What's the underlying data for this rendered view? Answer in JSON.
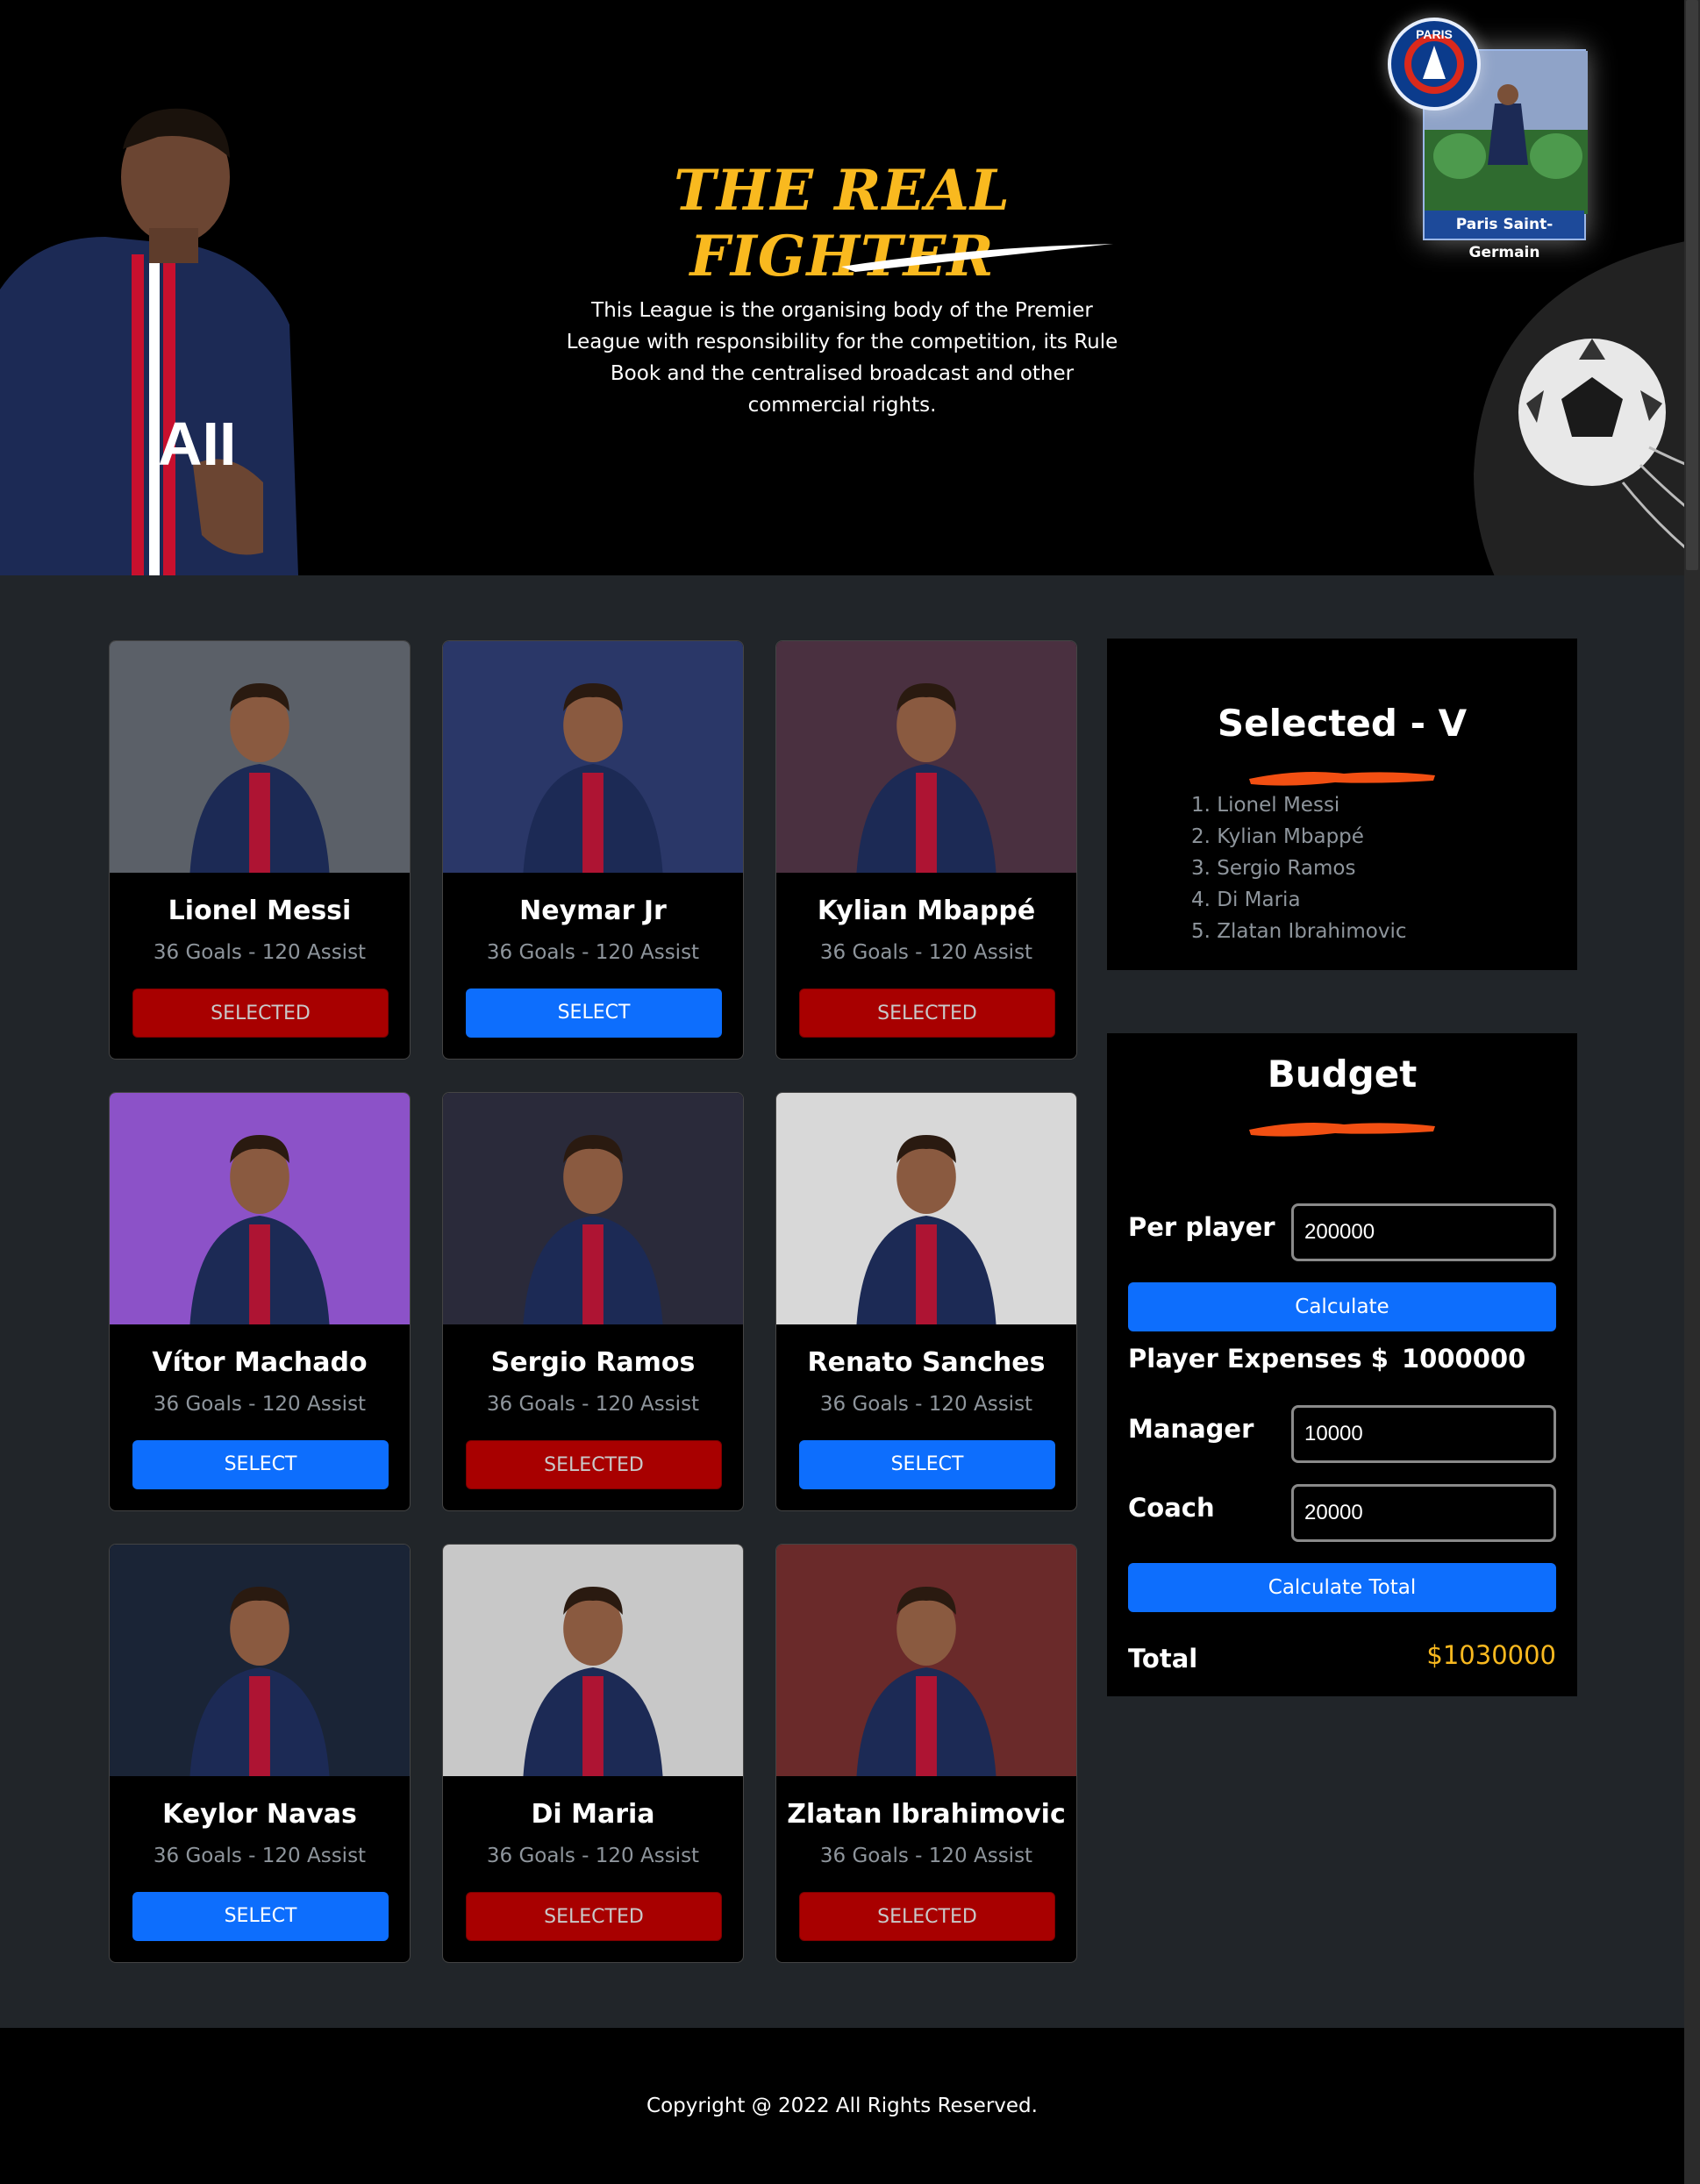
{
  "hero": {
    "title": "THE REAL FIGHTER",
    "description": "This League is the organising body of the Premier League with responsibility for the competition, its Rule Book and the centralised broadcast and other commercial rights.",
    "badge_text": "PARIS",
    "card_label": "Paris Saint-Germain"
  },
  "players": [
    {
      "name": "Lionel Messi",
      "stats": "36 Goals - 120 Assist",
      "button": "SELECTED",
      "selected": true,
      "bg": "#5b6068"
    },
    {
      "name": "Neymar Jr",
      "stats": "36 Goals - 120 Assist",
      "button": "SELECT",
      "selected": false,
      "bg": "#2a3768"
    },
    {
      "name": "Kylian Mbappé",
      "stats": "36 Goals - 120 Assist",
      "button": "SELECTED",
      "selected": true,
      "bg": "#4a3040"
    },
    {
      "name": "Vítor Machado",
      "stats": "36 Goals - 120 Assist",
      "button": "SELECT",
      "selected": false,
      "bg": "#8c52c8"
    },
    {
      "name": "Sergio Ramos",
      "stats": "36 Goals - 120 Assist",
      "button": "SELECTED",
      "selected": true,
      "bg": "#2a2a3a"
    },
    {
      "name": "Renato Sanches",
      "stats": "36 Goals - 120 Assist",
      "button": "SELECT",
      "selected": false,
      "bg": "#d8d8d8"
    },
    {
      "name": "Keylor Navas",
      "stats": "36 Goals - 120 Assist",
      "button": "SELECT",
      "selected": false,
      "bg": "#1a2436"
    },
    {
      "name": "Di Maria",
      "stats": "36 Goals - 120 Assist",
      "button": "SELECTED",
      "selected": true,
      "bg": "#c8c8c8"
    },
    {
      "name": "Zlatan Ibrahimovic",
      "stats": "36 Goals - 120 Assist",
      "button": "SELECTED",
      "selected": true,
      "bg": "#6a2a2a"
    }
  ],
  "selected_panel": {
    "title": "Selected - V",
    "items": [
      "Lionel Messi",
      "Kylian Mbappé",
      "Sergio Ramos",
      "Di Maria",
      "Zlatan Ibrahimovic"
    ]
  },
  "budget": {
    "title": "Budget",
    "per_player_label": "Per player",
    "per_player_value": "200000",
    "calculate_label": "Calculate",
    "player_expenses_label": "Player Expenses $",
    "player_expenses_value": "1000000",
    "manager_label": "Manager",
    "manager_value": "10000",
    "coach_label": "Coach",
    "coach_value": "20000",
    "calculate_total_label": "Calculate Total",
    "total_label": "Total",
    "total_value": "$1030000"
  },
  "footer": {
    "copyright": "Copyright @ 2022 All Rights Reserved."
  },
  "colors": {
    "accent_gold": "#f9b91f",
    "primary_blue": "#0d6efd",
    "selected_red": "#a80000",
    "brush_orange": "#f24f12"
  }
}
